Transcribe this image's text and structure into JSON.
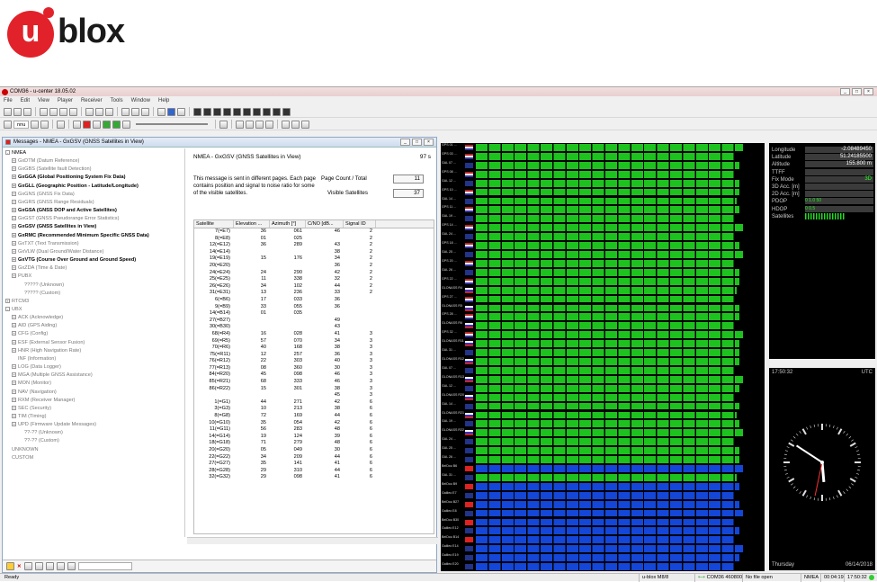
{
  "logo": {
    "text": "blox",
    "u": "u"
  },
  "window": {
    "title": "COM36 - u-center 18.05.02"
  },
  "menu": [
    "File",
    "Edit",
    "View",
    "Player",
    "Receiver",
    "Tools",
    "Window",
    "Help"
  ],
  "toolbar2": {
    "baud": "nnu"
  },
  "messages": {
    "title": "Messages - NMEA - GxGSV (GNSS Satellites in View)",
    "tree": [
      {
        "t": "NMEA",
        "l": 0,
        "ex": "-",
        "s": ""
      },
      {
        "t": "GxDTM (Datum Reference)",
        "l": 1,
        "ex": "+",
        "s": "d"
      },
      {
        "t": "GxGBS (Satellite fault Detection)",
        "l": 1,
        "ex": "+",
        "s": "d"
      },
      {
        "t": "GxGGA (Global Positioning System Fix Data)",
        "l": 1,
        "ex": "+",
        "s": "b"
      },
      {
        "t": "GxGLL (Geographic Position - Latitude/Longitude)",
        "l": 1,
        "ex": "+",
        "s": "b"
      },
      {
        "t": "GxGNS (GNSS Fix Data)",
        "l": 1,
        "ex": "+",
        "s": "d"
      },
      {
        "t": "GxGRS (GNSS Range Residuals)",
        "l": 1,
        "ex": "+",
        "s": "d"
      },
      {
        "t": "GxGSA (GNSS DOP and Active Satellites)",
        "l": 1,
        "ex": "+",
        "s": "b"
      },
      {
        "t": "GxGST (GNSS Pseudorange Error Statistics)",
        "l": 1,
        "ex": "+",
        "s": "d"
      },
      {
        "t": "GxGSV (GNSS Satellites in View)",
        "l": 1,
        "ex": "+",
        "s": "b"
      },
      {
        "t": "GxRMC (Recommended Minimum Specific GNSS Data)",
        "l": 1,
        "ex": "+",
        "s": "b"
      },
      {
        "t": "GxTXT (Text Transmission)",
        "l": 1,
        "ex": "+",
        "s": "d"
      },
      {
        "t": "GxVLW (Dual Ground/Water Distance)",
        "l": 1,
        "ex": "+",
        "s": "d"
      },
      {
        "t": "GxVTG (Course Over Ground and Ground Speed)",
        "l": 1,
        "ex": "+",
        "s": "b"
      },
      {
        "t": "GxZDA (Time & Date)",
        "l": 1,
        "ex": "+",
        "s": "d"
      },
      {
        "t": "PUBX",
        "l": 1,
        "ex": "+",
        "s": "d"
      },
      {
        "t": "????? (Unknown)",
        "l": 2,
        "ex": "",
        "s": "d"
      },
      {
        "t": "????? (Custom)",
        "l": 2,
        "ex": "",
        "s": "d"
      },
      {
        "t": "RTCM3",
        "l": 0,
        "ex": "+",
        "s": "d"
      },
      {
        "t": "UBX",
        "l": 0,
        "ex": "-",
        "s": "d"
      },
      {
        "t": "ACK (Acknowledge)",
        "l": 1,
        "ex": "+",
        "s": "d"
      },
      {
        "t": "AID (GPS Aiding)",
        "l": 1,
        "ex": "+",
        "s": "d"
      },
      {
        "t": "CFG (Config)",
        "l": 1,
        "ex": "+",
        "s": "d"
      },
      {
        "t": "ESF (External Sensor Fusion)",
        "l": 1,
        "ex": "+",
        "s": "d"
      },
      {
        "t": "HNR (High Navigation Rate)",
        "l": 1,
        "ex": "+",
        "s": "d"
      },
      {
        "t": "INF (Information)",
        "l": 1,
        "ex": "",
        "s": "d"
      },
      {
        "t": "LOG (Data Logger)",
        "l": 1,
        "ex": "+",
        "s": "d"
      },
      {
        "t": "MGA (Multiple GNSS Assistance)",
        "l": 1,
        "ex": "+",
        "s": "d"
      },
      {
        "t": "MON (Monitor)",
        "l": 1,
        "ex": "+",
        "s": "d"
      },
      {
        "t": "NAV (Navigation)",
        "l": 1,
        "ex": "+",
        "s": "d"
      },
      {
        "t": "RXM (Receiver Manager)",
        "l": 1,
        "ex": "+",
        "s": "d"
      },
      {
        "t": "SEC (Security)",
        "l": 1,
        "ex": "+",
        "s": "d"
      },
      {
        "t": "TIM (Timing)",
        "l": 1,
        "ex": "+",
        "s": "d"
      },
      {
        "t": "UPD (Firmware Update Messages)",
        "l": 1,
        "ex": "+",
        "s": "d"
      },
      {
        "t": "??-?? (Unknown)",
        "l": 2,
        "ex": "",
        "s": "d"
      },
      {
        "t": "??-?? (Custom)",
        "l": 2,
        "ex": "",
        "s": "d"
      },
      {
        "t": "UNKNOWN",
        "l": 0,
        "ex": "",
        "s": "d"
      },
      {
        "t": "CUSTOM",
        "l": 0,
        "ex": "",
        "s": "d"
      }
    ],
    "detail": {
      "title": "NMEA - GxGSV (GNSS Satellites in View)",
      "time": "97 s",
      "note": "This message is sent in different pages. Each page contains position and signal to noise ratio for some of the visible satellites.",
      "page_count_label": "Page Count / Total",
      "page_count": "11",
      "visible_label": "Visible Satellites",
      "visible": "37",
      "columns": [
        "Satellite",
        "Elevation ...",
        "Azimuth [°]",
        "C/NO [dB...",
        "Signal ID"
      ],
      "rows": [
        [
          "7(=E7)",
          "36",
          "061",
          "46",
          "2"
        ],
        [
          "8(=E8)",
          "01",
          "025",
          "",
          "2"
        ],
        [
          "12(=E12)",
          "36",
          "289",
          "43",
          "2"
        ],
        [
          "14(=E14)",
          "",
          "",
          "38",
          "2"
        ],
        [
          "19(=E19)",
          "15",
          "176",
          "34",
          "2"
        ],
        [
          "20(=E20)",
          "",
          "",
          "36",
          "2"
        ],
        [
          "24(=E24)",
          "24",
          "290",
          "42",
          "2"
        ],
        [
          "25(=E25)",
          "11",
          "338",
          "32",
          "2"
        ],
        [
          "26(=E26)",
          "34",
          "102",
          "44",
          "2"
        ],
        [
          "31(=E31)",
          "13",
          "236",
          "33",
          "2"
        ],
        [
          "6(=B6)",
          "17",
          "033",
          "36",
          ""
        ],
        [
          "9(=B9)",
          "33",
          "055",
          "36",
          ""
        ],
        [
          "14(=B14)",
          "01",
          "035",
          "",
          ""
        ],
        [
          "27(=B27)",
          "",
          "",
          "49",
          ""
        ],
        [
          "30(=B30)",
          "",
          "",
          "43",
          ""
        ],
        [
          "68(=R4)",
          "16",
          "028",
          "41",
          "3"
        ],
        [
          "69(=R5)",
          "57",
          "070",
          "34",
          "3"
        ],
        [
          "70(=R6)",
          "40",
          "168",
          "38",
          "3"
        ],
        [
          "75(=R11)",
          "12",
          "257",
          "36",
          "3"
        ],
        [
          "76(=R12)",
          "22",
          "303",
          "40",
          "3"
        ],
        [
          "77(=R13)",
          "08",
          "360",
          "30",
          "3"
        ],
        [
          "84(=R20)",
          "45",
          "098",
          "46",
          "3"
        ],
        [
          "85(=R21)",
          "68",
          "333",
          "46",
          "3"
        ],
        [
          "86(=R22)",
          "15",
          "301",
          "38",
          "3"
        ],
        [
          "",
          "",
          "",
          "45",
          "3"
        ],
        [
          "1(=G1)",
          "44",
          "271",
          "42",
          "6"
        ],
        [
          "3(=G3)",
          "10",
          "213",
          "38",
          "6"
        ],
        [
          "8(=G8)",
          "72",
          "169",
          "44",
          "6"
        ],
        [
          "10(=G10)",
          "35",
          "054",
          "42",
          "6"
        ],
        [
          "11(=G11)",
          "56",
          "283",
          "48",
          "6"
        ],
        [
          "14(=G14)",
          "19",
          "124",
          "39",
          "6"
        ],
        [
          "18(=G18)",
          "71",
          "279",
          "48",
          "6"
        ],
        [
          "20(=G20)",
          "05",
          "049",
          "30",
          "6"
        ],
        [
          "22(=G22)",
          "34",
          "209",
          "44",
          "6"
        ],
        [
          "27(=G27)",
          "35",
          "141",
          "41",
          "6"
        ],
        [
          "28(=G28)",
          "29",
          "310",
          "44",
          "6"
        ],
        [
          "32(=G32)",
          "29",
          "098",
          "41",
          "6"
        ]
      ]
    }
  },
  "signal": {
    "labels": [
      "GPS 01 ...",
      "GPS 03 ...",
      "GAL 07 ...",
      "GPS 08 ...",
      "GAL 12 ...",
      "GPS 10 ...",
      "GAL 14 ...",
      "GPS 11 ...",
      "GAL 19 ...",
      "GPS 14 ...",
      "GAL 24 ...",
      "GPS 18 ...",
      "GAL 25 ...",
      "GPS 20 ...",
      "GAL 26 ...",
      "GPS 22 ...",
      "GLONASS R4",
      "GPS 27 ...",
      "GLONASS R5",
      "GPS 28 ...",
      "GLONASS R6",
      "GPS 32 ...",
      "GLONASS R11",
      "GAL 31 ...",
      "GLONASS R12",
      "GAL 07 ...",
      "GLONASS R13",
      "GAL 12 ...",
      "GLONASS R20",
      "GAL 14 ...",
      "GLONASS R21",
      "GAL 19 ...",
      "GLONASS R22",
      "GAL 24 ...",
      "GAL 25 ...",
      "GAL 26 ...",
      "BeiDou B6",
      "GAL 31 ...",
      "BeiDou B9",
      "Galileo E7",
      "BeiDou B27",
      "Galileo E8",
      "BeiDou B30",
      "Galileo E12",
      "BeiDou B14",
      "Galileo E14",
      "Galileo E19",
      "Galileo E20"
    ],
    "levels": [
      0.93,
      0.9,
      0.92,
      0.9,
      0.92,
      0.92,
      0.91,
      0.92,
      0.9,
      0.93,
      0.9,
      0.92,
      0.93,
      0.9,
      0.92,
      0.92,
      0.91,
      0.9,
      0.92,
      0.92,
      0.9,
      0.93,
      0.92,
      0.92,
      0.92,
      0.9,
      0.93,
      0.92,
      0.9,
      0.92,
      0.91,
      0.92,
      0.93,
      0.9,
      0.92,
      0.92,
      0.93,
      0.91,
      0.92,
      0.9,
      0.92,
      0.93,
      0.9,
      0.92,
      0.9,
      0.93,
      0.92,
      0.9
    ]
  },
  "nav": {
    "rows": [
      {
        "label": "Longitude",
        "value": "-2.08489450"
      },
      {
        "label": "Latitude",
        "value": "51.24185500"
      },
      {
        "label": "Altitude",
        "value": "155.800 m"
      },
      {
        "label": "TTFF",
        "value": ""
      },
      {
        "label": "Fix Mode",
        "value": "3D"
      },
      {
        "label": "3D Acc. [m]",
        "value": ""
      },
      {
        "label": "2D Acc. [m]",
        "value": ""
      },
      {
        "label": "PDOP",
        "value": "0          1.0          50"
      },
      {
        "label": "HDOP",
        "value": "0    0.5"
      },
      {
        "label": "Satellites",
        "value": ""
      }
    ],
    "colors": {
      "fix": "#22ee22"
    }
  },
  "clock": {
    "time": "17:50:32",
    "tz": "UTC",
    "day": "Thursday",
    "date": "06/14/2018"
  },
  "status": {
    "ready": "Ready",
    "receiver": "u-blox M8/8",
    "port": "COM36 460800",
    "file": "No file open",
    "protocol": "NMEA",
    "elapsed": "00:04:19",
    "clock": "17:50:32"
  }
}
